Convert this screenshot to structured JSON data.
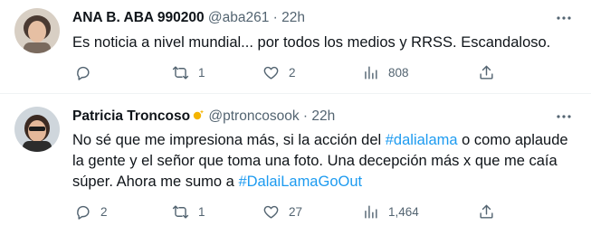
{
  "tweets": [
    {
      "author_name": "ANA B. ABA 990200",
      "handle": "@aba261",
      "separator": "·",
      "time": "22h",
      "text_parts": [
        "Es noticia a nivel mundial... por todos los medios y RRSS. Escandaloso."
      ],
      "hashtags": [],
      "counts": {
        "replies": "",
        "retweets": "1",
        "likes": "2",
        "views": "808"
      }
    },
    {
      "author_name": "Patricia Troncoso",
      "handle": "@ptroncosook",
      "separator": "·",
      "time": "22h",
      "text_parts": [
        "No sé que me impresiona más, si la acción del ",
        " o como aplaude la gente y el señor que toma una foto. Una decepción más x que me caía súper. Ahora me sumo a "
      ],
      "hashtags": [
        "#dalialama",
        "#DalaiLamaGoOut"
      ],
      "counts": {
        "replies": "2",
        "retweets": "1",
        "likes": "27",
        "views": "1,464"
      }
    }
  ],
  "colors": {
    "text": "#0f1419",
    "secondary": "#536471",
    "link": "#1d9bf0",
    "divider": "#eff3f4"
  },
  "icons": [
    "more-icon",
    "reply-icon",
    "retweet-icon",
    "like-icon",
    "views-icon",
    "share-icon",
    "sparkle-icon"
  ]
}
